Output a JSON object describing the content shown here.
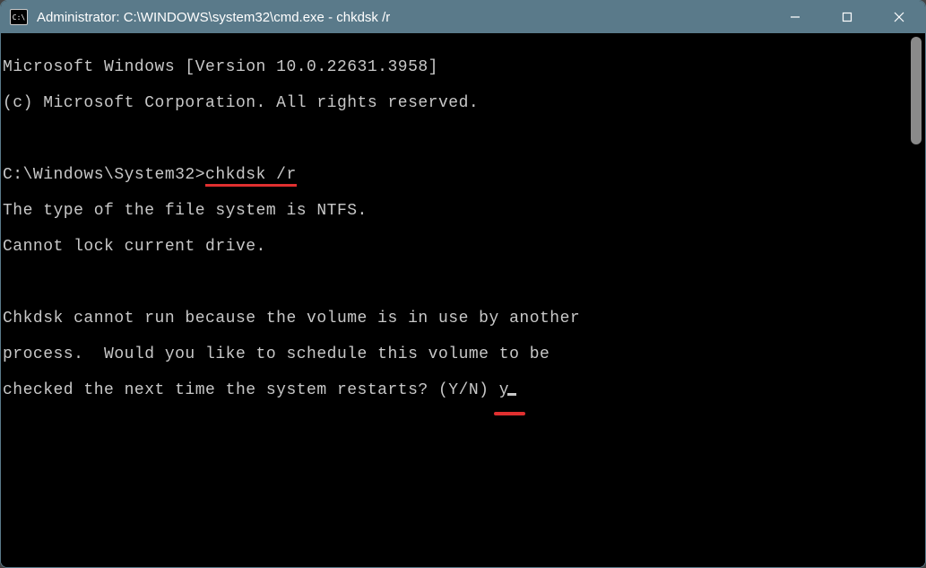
{
  "window": {
    "title": "Administrator: C:\\WINDOWS\\system32\\cmd.exe - chkdsk  /r"
  },
  "terminal": {
    "line1": "Microsoft Windows [Version 10.0.22631.3958]",
    "line2": "(c) Microsoft Corporation. All rights reserved.",
    "prompt": "C:\\Windows\\System32>",
    "command": "chkdsk /r",
    "out1": "The type of the file system is NTFS.",
    "out2": "Cannot lock current drive.",
    "out3": "Chkdsk cannot run because the volume is in use by another",
    "out4": "process.  Would you like to schedule this volume to be",
    "out5_pre": "checked the next time the system restarts? (Y/N) ",
    "out5_input": "y"
  },
  "icons": {
    "cmd_icon_text": "C:\\"
  }
}
